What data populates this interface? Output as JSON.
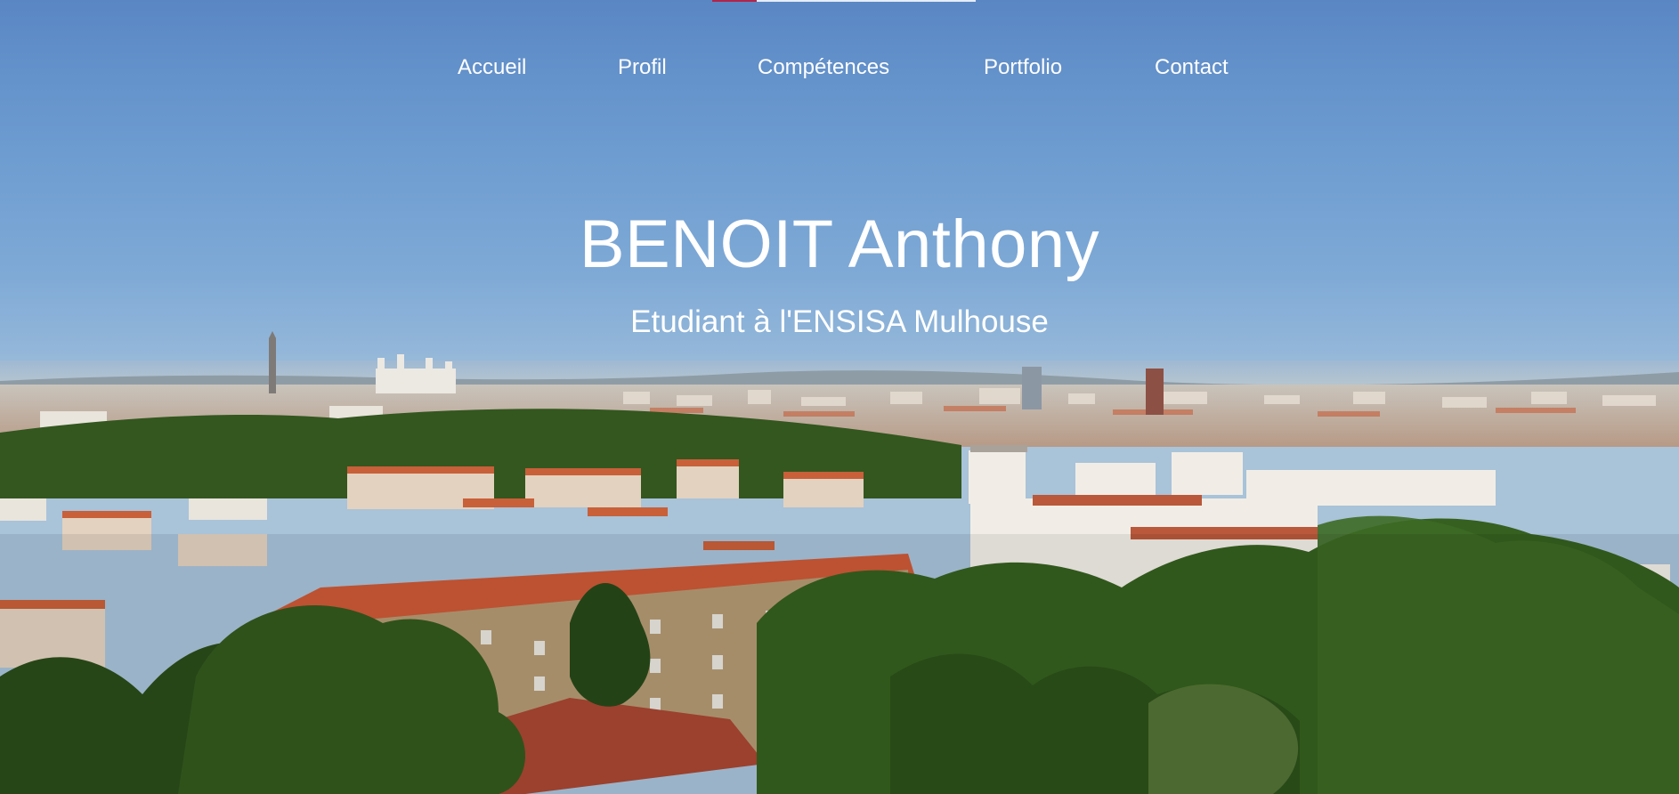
{
  "page": {
    "title": "BENOIT Anthony",
    "subtitle": "Etudiant à l'ENSISA Mulhouse",
    "scroll_progress": 0.17
  },
  "nav": {
    "items": [
      {
        "label": "Accueil"
      },
      {
        "label": "Profil"
      },
      {
        "label": "Compétences"
      },
      {
        "label": "Portfolio"
      },
      {
        "label": "Contact"
      }
    ]
  },
  "colors": {
    "sky_top": "#5a87c4",
    "roof_orange": "#c8603a",
    "foliage": "#2f5a1c",
    "progress_accent": "#b2244a",
    "text": "#ffffff"
  },
  "background": {
    "scene": "city-panorama"
  }
}
